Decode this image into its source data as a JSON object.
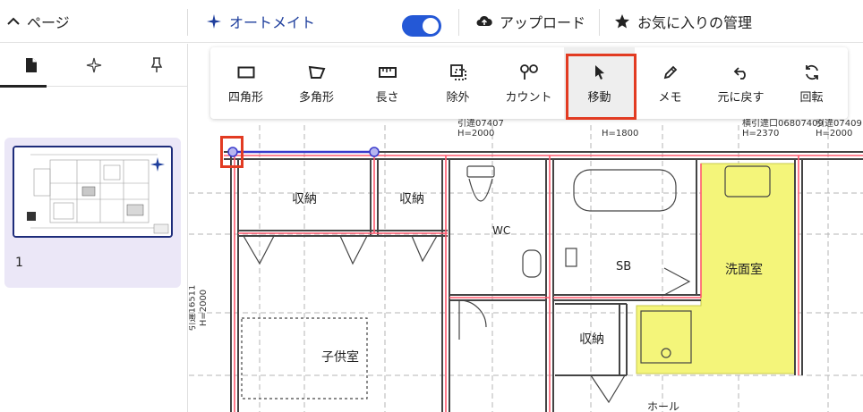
{
  "header": {
    "pages_label": "ページ",
    "automate_label": "オートメイト",
    "upload_label": "アップロード",
    "favorites_label": "お気に入りの管理"
  },
  "sidebar": {
    "tabs": [
      {
        "icon": "page-icon"
      },
      {
        "icon": "sparkle-icon"
      },
      {
        "icon": "pin-icon"
      }
    ],
    "pages": [
      {
        "number": "1"
      }
    ]
  },
  "toolbar": {
    "tools": [
      {
        "label": "四角形",
        "icon": "rectangle-icon"
      },
      {
        "label": "多角形",
        "icon": "polygon-icon"
      },
      {
        "label": "長さ",
        "icon": "ruler-icon"
      },
      {
        "label": "除外",
        "icon": "exclude-icon"
      },
      {
        "label": "カウント",
        "icon": "count-icon"
      },
      {
        "label": "移動",
        "icon": "pointer-icon",
        "active": true
      },
      {
        "label": "メモ",
        "icon": "pen-icon"
      },
      {
        "label": "元に戻す",
        "icon": "undo-icon"
      },
      {
        "label": "回転",
        "icon": "rotate-icon"
      }
    ]
  },
  "plan": {
    "rooms": [
      "収納",
      "収納",
      "WC",
      "SB",
      "洗面室",
      "収納",
      "子供室",
      "ホール"
    ],
    "annotations": [
      "引違07407",
      "H=2000",
      "引違07409",
      "H=1800",
      "横引違口06807409",
      "H=2370",
      "H=2000",
      "引違16511",
      "H=2000"
    ]
  },
  "colors": {
    "accent": "#2458d6",
    "highlight": "#e23b22",
    "area_fill": "#f4f57a",
    "selected_line": "#3a3acb",
    "card_bg": "#ebe7f7"
  }
}
